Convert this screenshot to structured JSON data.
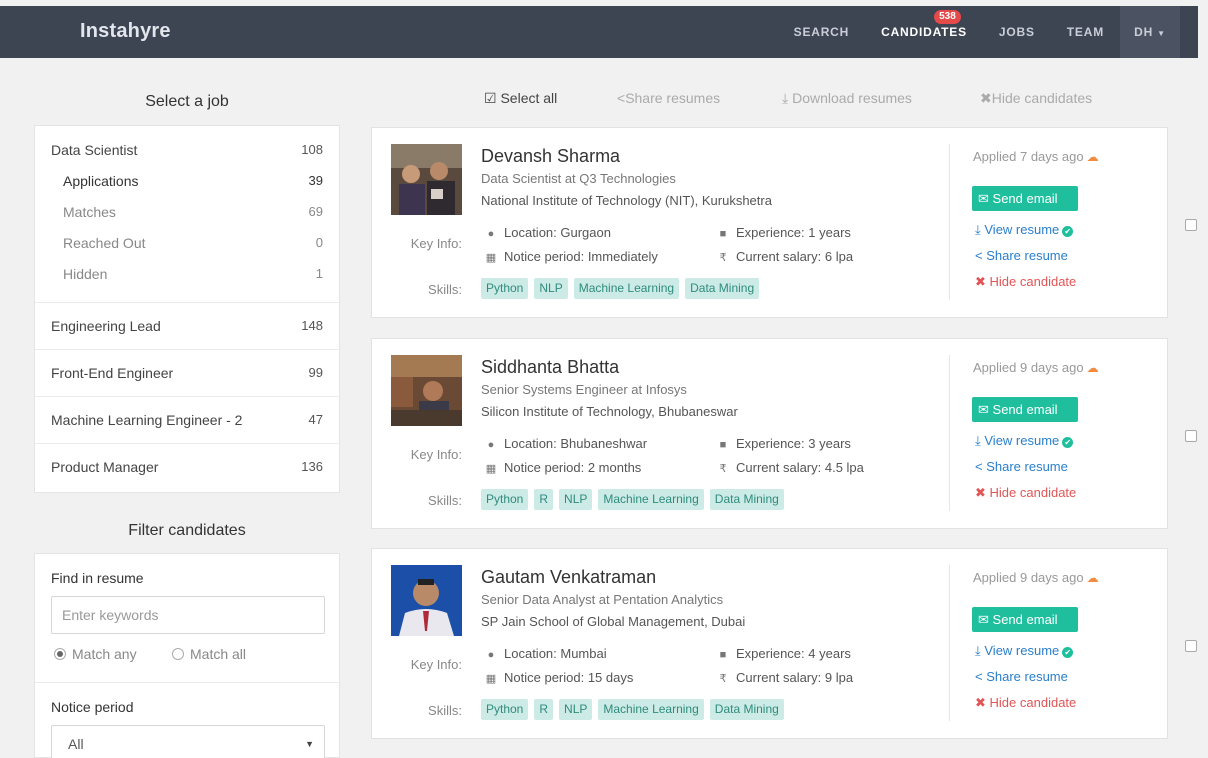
{
  "nav": {
    "brand": "Instahyre",
    "items": [
      {
        "label": "SEARCH"
      },
      {
        "label": "CANDIDATES",
        "badge": "538"
      },
      {
        "label": "JOBS"
      },
      {
        "label": "TEAM"
      },
      {
        "label": "DH"
      }
    ]
  },
  "sidebar": {
    "title": "Select a job",
    "jobs": [
      {
        "name": "Data Scientist",
        "count": "108",
        "sub": [
          {
            "name": "Applications",
            "count": "39"
          },
          {
            "name": "Matches",
            "count": "69"
          },
          {
            "name": "Reached Out",
            "count": "0"
          },
          {
            "name": "Hidden",
            "count": "1"
          }
        ]
      },
      {
        "name": "Engineering Lead",
        "count": "148"
      },
      {
        "name": "Front-End Engineer",
        "count": "99"
      },
      {
        "name": "Machine Learning Engineer - 2",
        "count": "47"
      },
      {
        "name": "Product Manager",
        "count": "136"
      }
    ],
    "filter_title": "Filter candidates",
    "find_label": "Find in resume",
    "keyword_placeholder": "Enter keywords",
    "match_any": "Match any",
    "match_all": "Match all",
    "notice_label": "Notice period",
    "notice_value": "All"
  },
  "toolbar": {
    "select_all": "Select all",
    "share": "Share resumes",
    "download": "Download resumes",
    "hide": "Hide candidates"
  },
  "labels": {
    "key_info": "Key Info:",
    "skills": "Skills:",
    "send_email": "Send email",
    "view_resume": "View resume",
    "share_resume": "Share resume",
    "hide_candidate": "Hide candidate"
  },
  "candidates": [
    {
      "name": "Devansh Sharma",
      "title": "Data Scientist at Q3 Technologies",
      "school": "National Institute of Technology (NIT), Kurukshetra",
      "location": "Location: Gurgaon",
      "experience": "Experience: 1 years",
      "notice": "Notice period: Immediately",
      "salary": "Current salary: 6 lpa",
      "skills": [
        "Python",
        "NLP",
        "Machine Learning",
        "Data Mining"
      ],
      "applied": "Applied 7 days ago"
    },
    {
      "name": "Siddhanta Bhatta",
      "title": "Senior Systems Engineer at Infosys",
      "school": "Silicon Institute of Technology, Bhubaneswar",
      "location": "Location: Bhubaneshwar",
      "experience": "Experience: 3 years",
      "notice": "Notice period: 2 months",
      "salary": "Current salary: 4.5 lpa",
      "skills": [
        "Python",
        "R",
        "NLP",
        "Machine Learning",
        "Data Mining"
      ],
      "applied": "Applied 9 days ago"
    },
    {
      "name": "Gautam Venkatraman",
      "title": "Senior Data Analyst at Pentation Analytics",
      "school": "SP Jain School of Global Management, Dubai",
      "location": "Location: Mumbai",
      "experience": "Experience: 4 years",
      "notice": "Notice period: 15 days",
      "salary": "Current salary: 9 lpa",
      "skills": [
        "Python",
        "R",
        "NLP",
        "Machine Learning",
        "Data Mining"
      ],
      "applied": "Applied 9 days ago"
    }
  ],
  "colors": {
    "nav_bg": "#3d4452",
    "accent": "#1fbf9e",
    "link": "#2a7fcb",
    "danger": "#e05555",
    "badge": "#e44a4a"
  },
  "icons": [
    "check-square-icon",
    "share-icon",
    "download-icon",
    "times-icon",
    "map-marker-icon",
    "briefcase-icon",
    "calendar-icon",
    "rupee-icon",
    "cloud-icon",
    "envelope-icon",
    "check-circle-icon",
    "caret-down-icon"
  ]
}
